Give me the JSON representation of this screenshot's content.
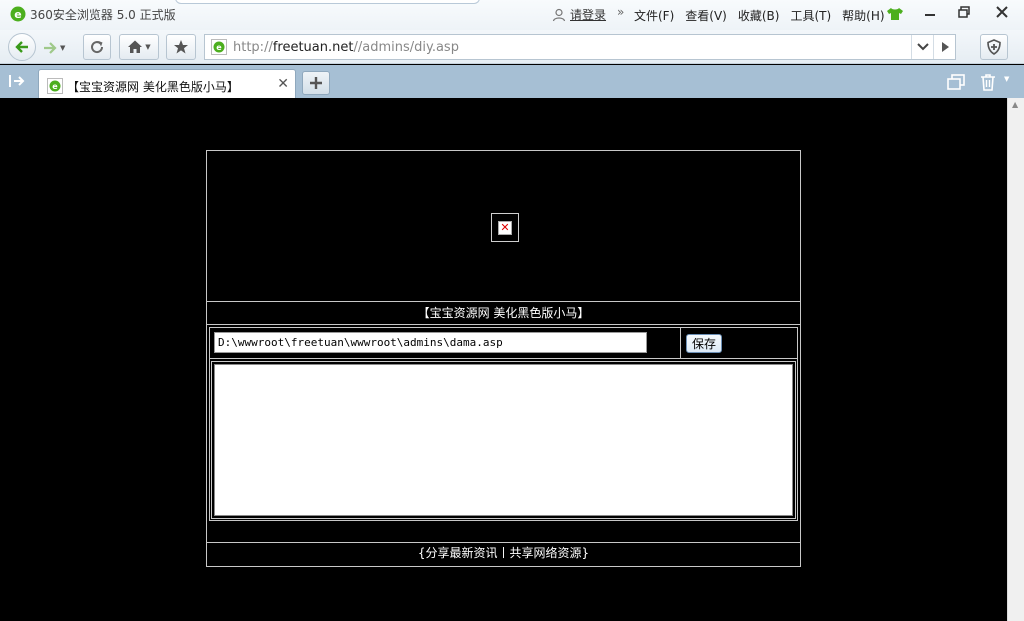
{
  "browser": {
    "app_title": "360安全浏览器 5.0 正式版",
    "login_label": "请登录",
    "menu_separator": "»",
    "menu": [
      "文件(F)",
      "查看(V)",
      "收藏(B)",
      "工具(T)",
      "帮助(H)"
    ]
  },
  "address": {
    "scheme": "http://",
    "host": "freetuan.net",
    "path": "//admins/diy.asp"
  },
  "tabs": [
    {
      "title": "【宝宝资源网 美化黑色版小马】",
      "active": true
    }
  ],
  "page": {
    "header_title": "【宝宝资源网 美化黑色版小马】",
    "path_value": "D:\\wwwroot\\freetuan\\wwwroot\\admins\\dama.asp",
    "save_label": "保存",
    "content_value": "",
    "footer_text": "{分享最新资讯丨共享网络资源}"
  },
  "colors": {
    "page_background": "#000000",
    "border": "#c8c8c8",
    "tabbar": "#a6bfd4",
    "accent_green": "#4caf1e"
  },
  "icons": [
    "browser-logo-icon",
    "user-icon",
    "skin-shirt-icon",
    "minimize-icon",
    "restore-icon",
    "close-icon",
    "back-icon",
    "forward-icon",
    "refresh-icon",
    "home-icon",
    "favorite-star-icon",
    "site-favicon-icon",
    "address-dropdown-icon",
    "go-icon",
    "shield-icon",
    "sidebar-toggle-icon",
    "tab-close-icon",
    "new-tab-icon",
    "restore-tabs-icon",
    "trash-icon",
    "broken-image-icon"
  ]
}
